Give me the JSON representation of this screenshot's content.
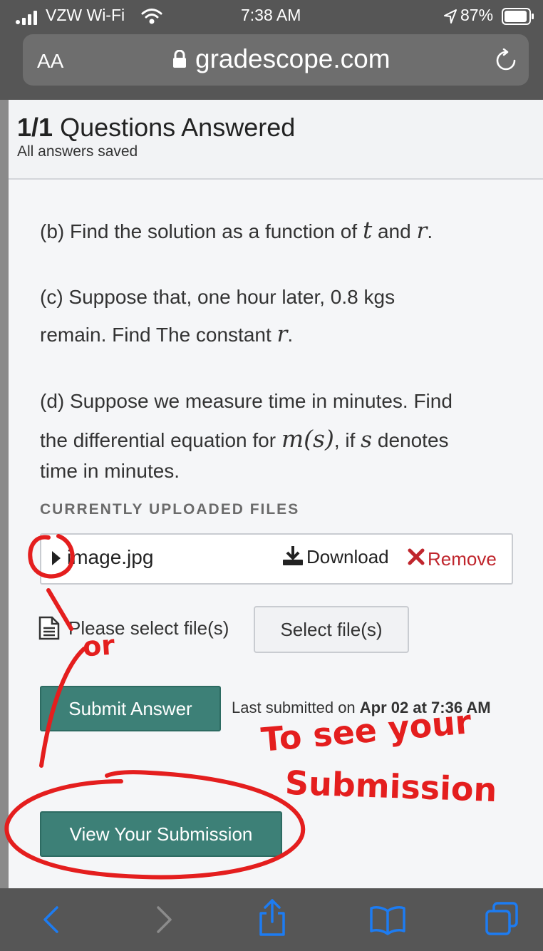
{
  "status_bar": {
    "carrier": "VZW Wi-Fi",
    "time": "7:38 AM",
    "battery": "87%"
  },
  "url_bar": {
    "text_size_label": "AA",
    "domain": "gradescope.com",
    "icons": [
      "lock-icon",
      "reload-icon"
    ]
  },
  "header": {
    "count": "1/1",
    "title": "Questions Answered",
    "subtitle": "All answers saved"
  },
  "question": {
    "b_prefix": "(b) Find the solution as a function of",
    "b_var1": "t",
    "b_and": "and",
    "b_var2": "r",
    "b_end": ".",
    "c_line1": "(c) Suppose that, one  hour later, 0.8 kgs",
    "c_line2_prefix": "remain. Find The constant",
    "c_var": "r",
    "c_end": ".",
    "d_line1": "(d) Suppose we measure time in minutes. Find",
    "d_line2_prefix": "the differential equation for",
    "d_expr": "m(s)",
    "d_line2_mid": ", if",
    "d_var": "s",
    "d_line2_end": "denotes",
    "d_line3": "time in minutes."
  },
  "uploads": {
    "heading": "CURRENTLY UPLOADED FILES",
    "file_name": "image.jpg",
    "download_label": "Download",
    "remove_label": "Remove",
    "select_placeholder": "Please select file(s)",
    "select_button": "Select file(s)"
  },
  "actions": {
    "submit_label": "Submit Answer",
    "last_submitted_prefix": "Last submitted on",
    "last_submitted_date": "Apr 02 at 7:36 AM",
    "view_label": "View Your Submission"
  },
  "annotations": {
    "or_text": "or",
    "note_line1": "To see your",
    "note_line2": "Submission",
    "color": "#e41e1e"
  },
  "colors": {
    "accent_green": "#3d8077",
    "remove_red": "#c0262d",
    "ios_blue": "#1d7cf2"
  }
}
